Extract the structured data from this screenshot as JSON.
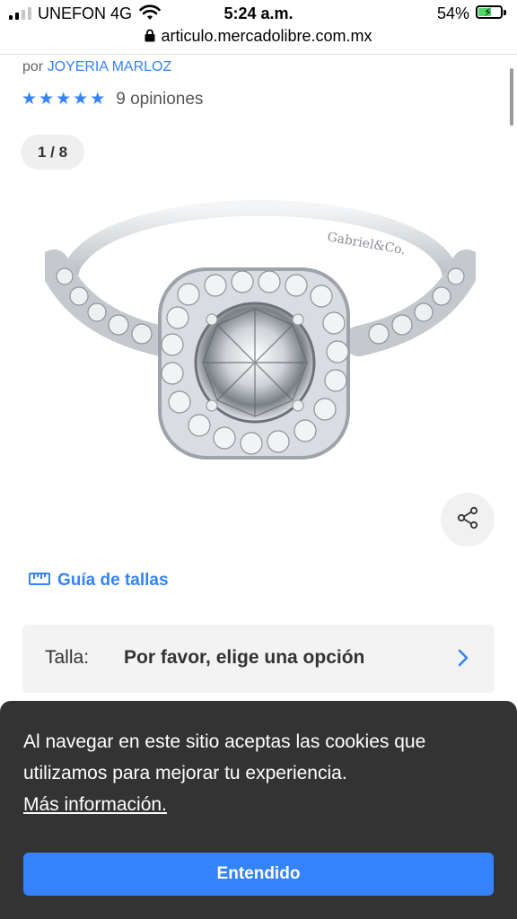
{
  "status_bar": {
    "carrier": "UNEFON 4G",
    "time": "5:24 a.m.",
    "battery": "54%",
    "battery_level": 0.54,
    "icons": [
      "signal-icon",
      "wifi-icon",
      "battery-charging-icon"
    ]
  },
  "browser": {
    "url": "articulo.mercadolibre.com.mx",
    "icon": "lock-icon"
  },
  "seller": {
    "prefix": "por",
    "name": "JOYERIA MARLOZ"
  },
  "rating": {
    "stars": 5,
    "opinions": "9 opiniones"
  },
  "gallery": {
    "counter": "1 / 8",
    "ring_engraving": "Gabriel&Co."
  },
  "size_guide": {
    "label": "Guía de tallas",
    "icon": "ruler-icon"
  },
  "variant": {
    "label": "Talla:",
    "value": "Por favor, elige una opción"
  },
  "cookie_banner": {
    "message": "Al navegar en este sitio aceptas las cookies que utilizamos para mejorar tu experiencia.",
    "more_link": "Más información.",
    "button": "Entendido"
  },
  "colors": {
    "accent": "#3483fa",
    "banner_bg": "#333333",
    "battery_green": "#4cd964"
  }
}
